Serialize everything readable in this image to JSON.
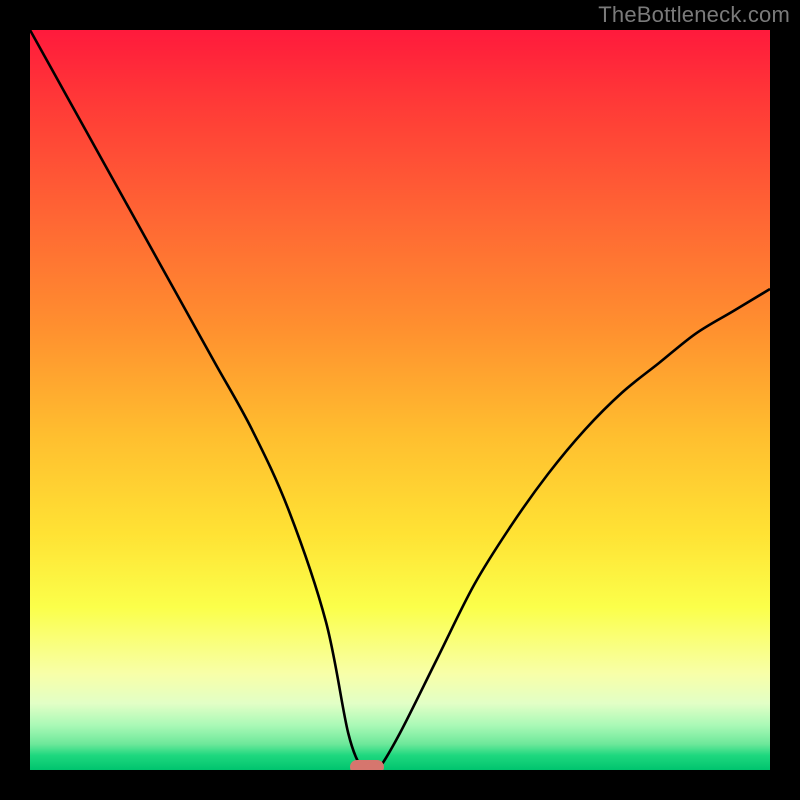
{
  "watermark": "TheBottleneck.com",
  "chart_data": {
    "type": "line",
    "title": "",
    "xlabel": "",
    "ylabel": "",
    "xlim": [
      0,
      100
    ],
    "ylim": [
      0,
      100
    ],
    "series": [
      {
        "name": "bottleneck-curve",
        "x": [
          0,
          5,
          10,
          15,
          20,
          25,
          30,
          35,
          40,
          43,
          45,
          46,
          47,
          50,
          55,
          60,
          65,
          70,
          75,
          80,
          85,
          90,
          95,
          100
        ],
        "values": [
          100,
          91,
          82,
          73,
          64,
          55,
          46,
          35,
          20,
          5,
          0,
          0,
          0,
          5,
          15,
          25,
          33,
          40,
          46,
          51,
          55,
          59,
          62,
          65
        ]
      }
    ],
    "marker": {
      "x": 45.5,
      "y": 0
    },
    "background": "vertical-green-to-red-gradient"
  }
}
